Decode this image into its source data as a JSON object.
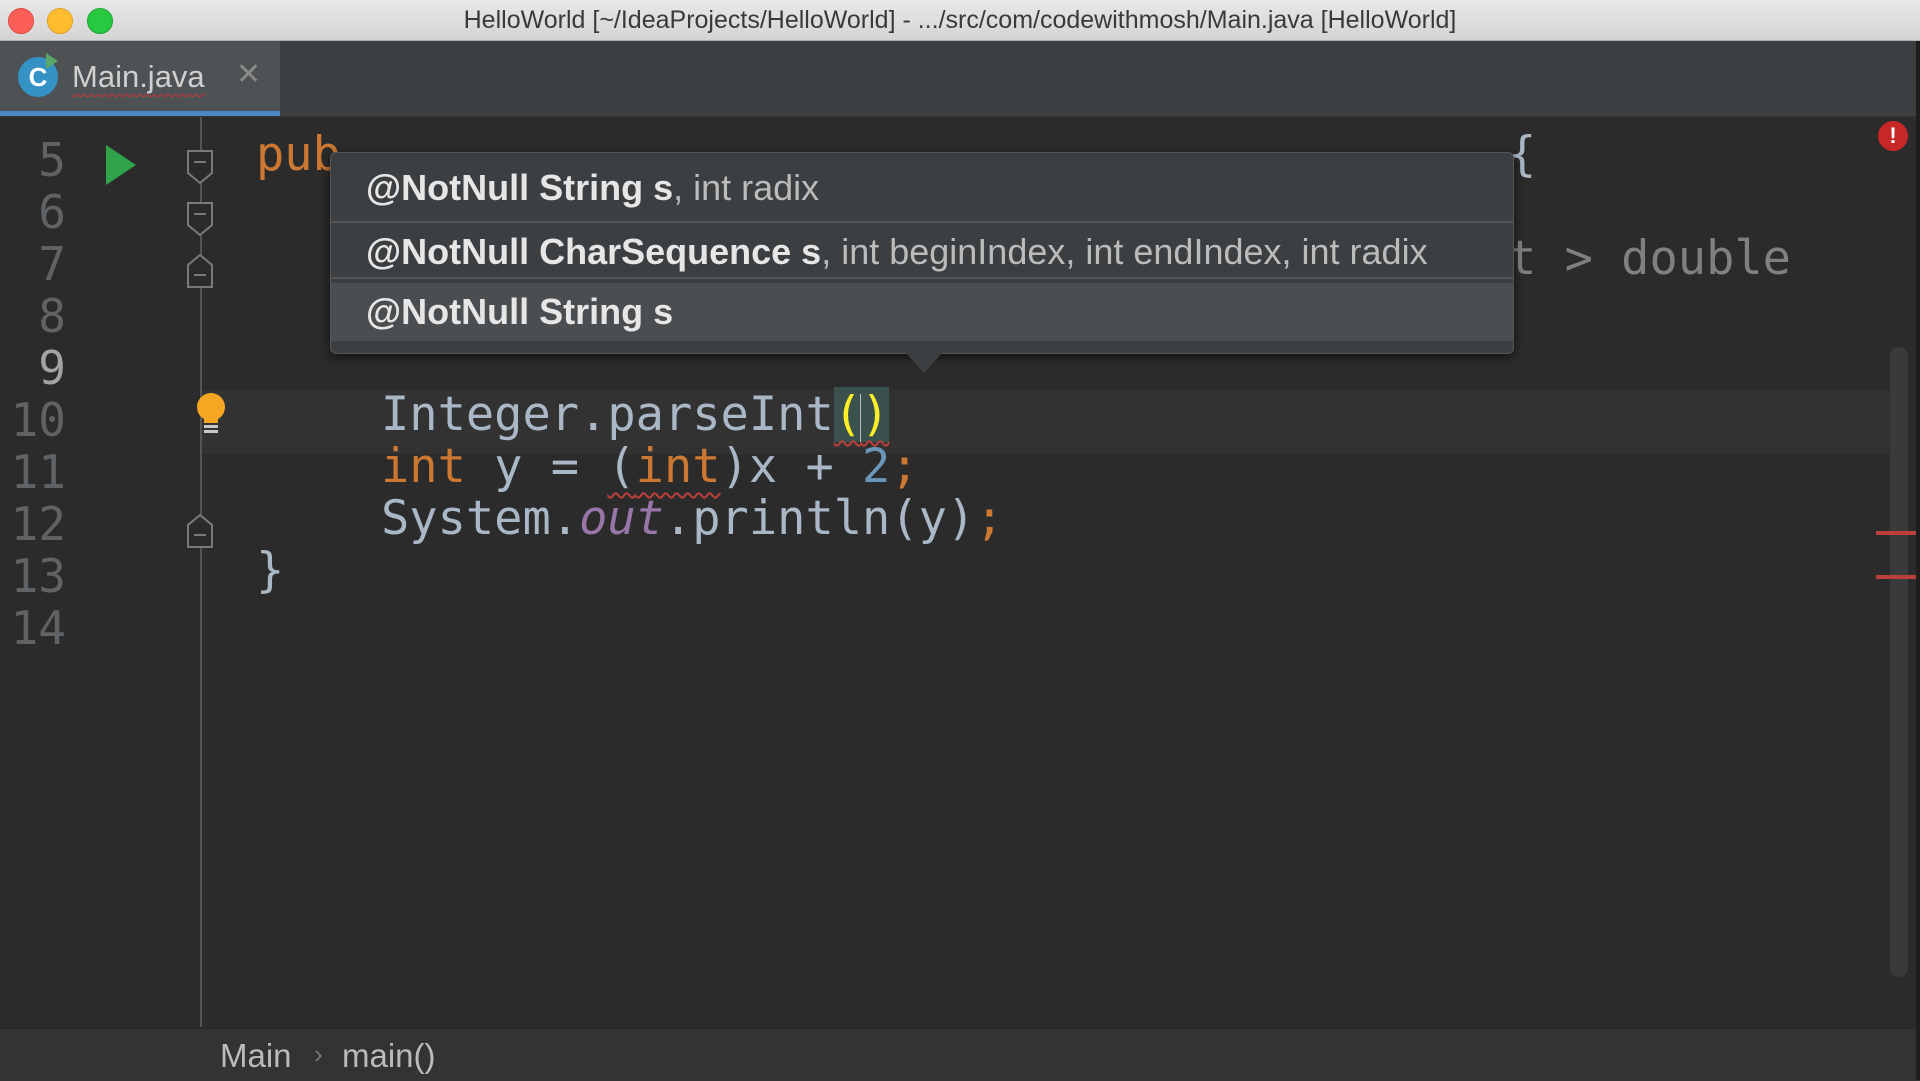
{
  "window": {
    "title": "HelloWorld [~/IdeaProjects/HelloWorld] - .../src/com/codewithmosh/Main.java [HelloWorld]"
  },
  "tabs": [
    {
      "label": "Main.java",
      "icon": "java-class-icon",
      "icon_letter": "C",
      "close": "✕"
    }
  ],
  "gutter": {
    "line_numbers": [
      "5",
      "6",
      "7",
      "8",
      "9",
      "10",
      "11",
      "12",
      "13",
      "14"
    ],
    "current_line": "9"
  },
  "code": {
    "line5_visible": "pub",
    "line5_brace": "{",
    "line7_visible": "t > double",
    "line9_prefix": "Integer.parseInt",
    "line9_open": "(",
    "line9_close": ")",
    "line10_kw": "int",
    "line10_mid": " y = ",
    "line10_cast_open": "(",
    "line10_cast_kw": "int",
    "line10_cast_rest": ")x + ",
    "line10_num": "2",
    "line10_end": ";",
    "line11_prefix": "System.",
    "line11_field": "out",
    "line11_rest": ".println(y)",
    "line11_end": ";",
    "line12": "}"
  },
  "parameter_popup": {
    "items": [
      {
        "bold": "@NotNull String s",
        "rest": ", int radix"
      },
      {
        "bold": "@NotNull CharSequence s",
        "rest": ", int beginIndex, int endIndex, int radix"
      },
      {
        "bold": "@NotNull String s",
        "rest": ""
      }
    ]
  },
  "breadcrumb": {
    "items": [
      "Main",
      "main()"
    ],
    "separator": "›"
  },
  "colors": {
    "keyword": "#cc7832",
    "number": "#6897bb",
    "field": "#9876aa",
    "bracket_highlight": "#ffef28",
    "error": "#bc3f3c",
    "tab_accent": "#4a88c7"
  }
}
